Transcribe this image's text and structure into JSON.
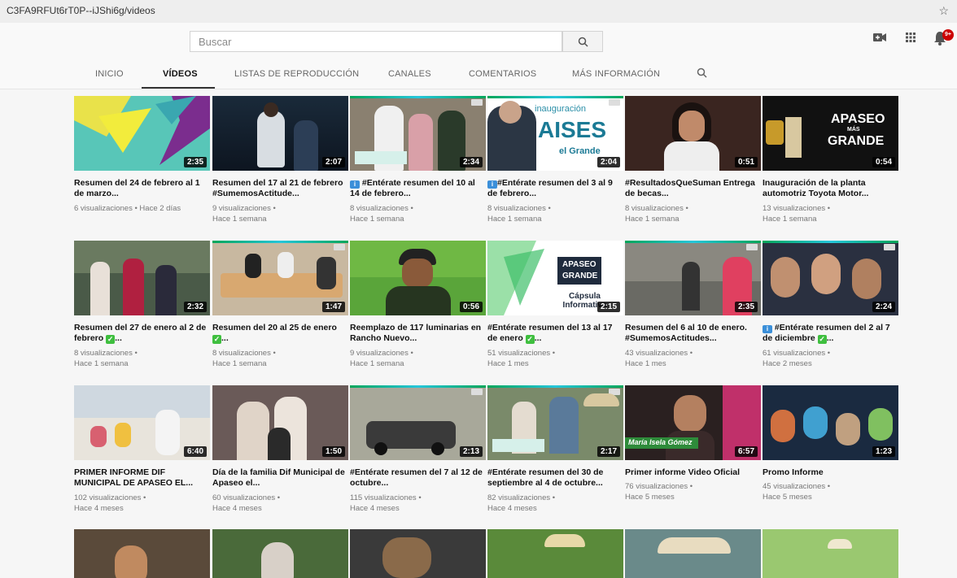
{
  "browser": {
    "url": "C3FA9RFUt6rT0P--iJShi6g/videos"
  },
  "search": {
    "placeholder": "Buscar"
  },
  "notifications": {
    "badge": "9+"
  },
  "tabs": [
    {
      "label": "INICIO"
    },
    {
      "label": "VÍDEOS"
    },
    {
      "label": "LISTAS DE REPRODUCCIÓN"
    },
    {
      "label": "CANALES"
    },
    {
      "label": "COMENTARIOS"
    },
    {
      "label": "MÁS INFORMACIÓN"
    }
  ],
  "videos": [
    {
      "title": "Resumen del 24 de febrero al 1 de marzo...",
      "views": "6 visualizaciones • Hace 2 días",
      "age": "",
      "duration": "2:35"
    },
    {
      "title": "Resumen del 17 al 21 de febrero #SumemosActitude...",
      "views": "9 visualizaciones •",
      "age": "Hace 1 semana",
      "duration": "2:07"
    },
    {
      "title": "#Entérate resumen del 10 al 14 de febrero...",
      "views": "8 visualizaciones •",
      "age": "Hace 1 semana",
      "duration": "2:34"
    },
    {
      "title": "#Entérate resumen del 3 al 9 de febrero...",
      "views": "8 visualizaciones •",
      "age": "Hace 1 semana",
      "duration": "2:04",
      "thumb_text": "inauguración",
      "thumb_text2": "AISES",
      "thumb_text3": "el Grande"
    },
    {
      "title": "#ResultadosQueSuman Entrega de becas...",
      "views": "8 visualizaciones •",
      "age": "Hace 1 semana",
      "duration": "0:51"
    },
    {
      "title": "Inauguración de la planta automotriz Toyota Motor...",
      "views": "13 visualizaciones •",
      "age": "Hace 1 semana",
      "duration": "0:54",
      "thumb_text": "APASEO",
      "thumb_text2": "MÁS",
      "thumb_text3": "GRANDE"
    },
    {
      "title": "Resumen del 27 de enero al 2 de febrero",
      "views": "8 visualizaciones •",
      "age": "Hace 1 semana",
      "duration": "2:32"
    },
    {
      "title": "Resumen del 20 al 25 de enero",
      "views": "8 visualizaciones •",
      "age": "Hace 1 semana",
      "duration": "1:47"
    },
    {
      "title": "Reemplazo de 117 luminarias en Rancho Nuevo...",
      "views": "9 visualizaciones •",
      "age": "Hace 1 semana",
      "duration": "0:56"
    },
    {
      "title": "#Entérate resumen del 13 al 17 de enero",
      "views": "51 visualizaciones •",
      "age": "Hace 1 mes",
      "duration": "2:15",
      "thumb_text": "APASEO",
      "thumb_text2": "GRANDE",
      "thumb_text3": "Cápsula Informativa"
    },
    {
      "title": "Resumen del 6 al 10 de enero. #SumemosActitudes...",
      "views": "43 visualizaciones •",
      "age": "Hace 1 mes",
      "duration": "2:35"
    },
    {
      "title": "#Entérate resumen del 2 al 7 de diciembre",
      "views": "61 visualizaciones •",
      "age": "Hace 2 meses",
      "duration": "2:24"
    },
    {
      "title": "PRIMER INFORME DIF MUNICIPAL DE APASEO EL...",
      "views": "102 visualizaciones •",
      "age": "Hace 4 meses",
      "duration": "6:40"
    },
    {
      "title": "Día de la familia Dif Municipal de Apaseo el...",
      "views": "60 visualizaciones •",
      "age": "Hace 4 meses",
      "duration": "1:50"
    },
    {
      "title": "#Entérate resumen del 7 al 12 de octubre...",
      "views": "115 visualizaciones •",
      "age": "Hace 4 meses",
      "duration": "2:13"
    },
    {
      "title": "#Entérate resumen del 30 de septiembre al 4 de octubre...",
      "views": "82 visualizaciones •",
      "age": "Hace 4 meses",
      "duration": "2:17"
    },
    {
      "title": "Primer informe Video Oficial",
      "views": "76 visualizaciones •",
      "age": "Hace 5 meses",
      "duration": "6:57",
      "thumb_text": "María Isela Gómez"
    },
    {
      "title": "Promo Informe",
      "views": "45 visualizaciones •",
      "age": "Hace 5 meses",
      "duration": "1:23"
    },
    {
      "title": "",
      "views": "",
      "age": "",
      "duration": ""
    },
    {
      "title": "",
      "views": "",
      "age": "",
      "duration": ""
    },
    {
      "title": "",
      "views": "",
      "age": "",
      "duration": ""
    },
    {
      "title": "",
      "views": "",
      "age": "",
      "duration": ""
    },
    {
      "title": "",
      "views": "",
      "age": "",
      "duration": ""
    },
    {
      "title": "",
      "views": "",
      "age": "",
      "duration": ""
    }
  ],
  "icons": [
    "star-icon",
    "search-icon",
    "video-camera-icon",
    "apps-grid-icon",
    "bell-icon",
    "info-icon",
    "check-icon"
  ],
  "colors": {
    "accent_green": "#00a65a",
    "badge_red": "#cc0000",
    "check_green": "#3fbf3f",
    "info_blue": "#3b8fd9"
  }
}
